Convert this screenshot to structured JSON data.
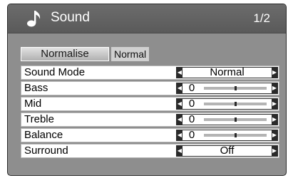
{
  "header": {
    "title": "Sound",
    "page": "1/2",
    "icon": "music-note-icon"
  },
  "normalise": {
    "button_label": "Normalise",
    "status": "Normal"
  },
  "settings": [
    {
      "label": "Sound Mode",
      "type": "select",
      "value": "Normal"
    },
    {
      "label": "Bass",
      "type": "slider",
      "value": "0",
      "level": 0.5
    },
    {
      "label": "Mid",
      "type": "slider",
      "value": "0",
      "level": 0.5
    },
    {
      "label": "Treble",
      "type": "slider",
      "value": "0",
      "level": 0.5
    },
    {
      "label": "Balance",
      "type": "slider",
      "value": "0",
      "level": 0.5
    },
    {
      "label": "Surround",
      "type": "select",
      "value": "Off"
    }
  ],
  "colors": {
    "panel": "#8e8e8e",
    "header": "#626262",
    "row": "#ffffff",
    "control_border": "#2a2a2a"
  }
}
